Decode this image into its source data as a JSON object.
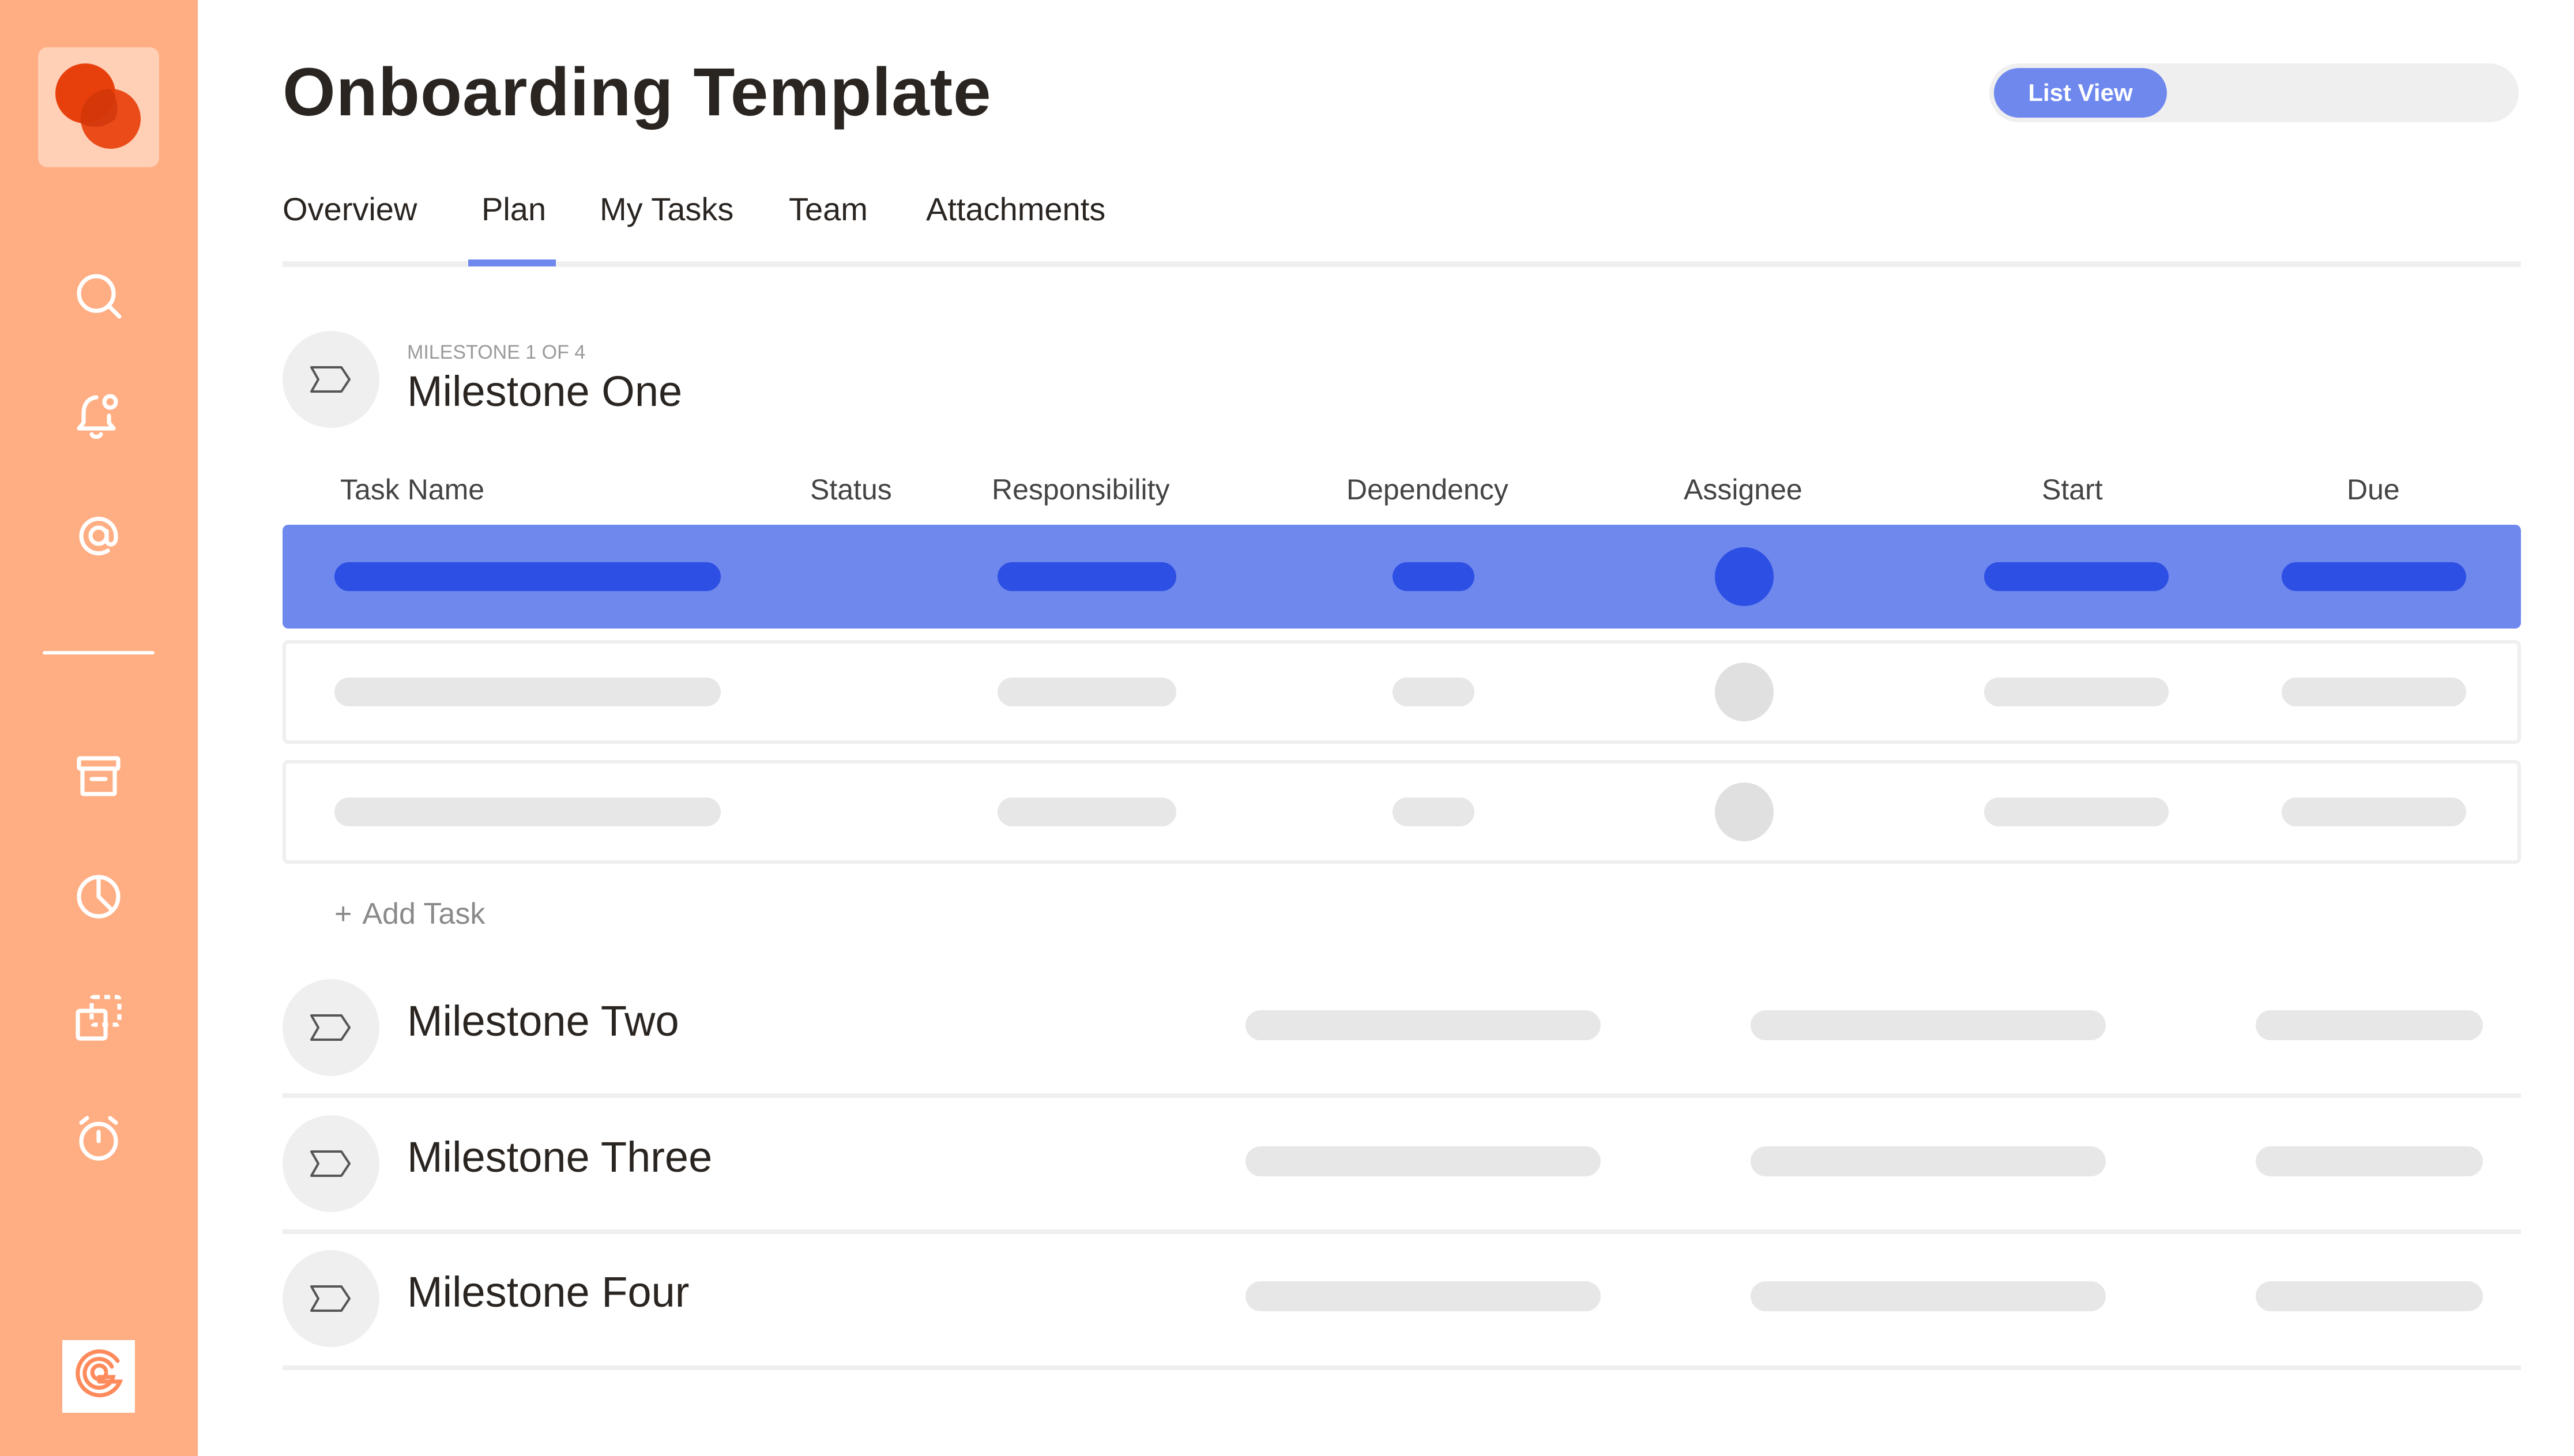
{
  "app": {
    "accent_color": "#6e88ee",
    "sidebar_color": "#ffad82",
    "logo_name": "overlapping-circles-logo",
    "brand_badge_name": "g-brand-icon"
  },
  "sidebar": {
    "icons": [
      "search-icon",
      "bell-icon",
      "at-sign-icon",
      "archive-icon",
      "pie-chart-icon",
      "duplicate-icon",
      "stopwatch-icon"
    ]
  },
  "header": {
    "title": "Onboarding Template",
    "view_toggle": {
      "selected": "List View"
    }
  },
  "tabs": [
    {
      "label": "Overview",
      "active": false
    },
    {
      "label": "Plan",
      "active": true
    },
    {
      "label": "My Tasks",
      "active": false
    },
    {
      "label": "Team",
      "active": false
    },
    {
      "label": "Attachments",
      "active": false
    }
  ],
  "milestones": [
    {
      "kicker": "MILESTONE 1 OF 4",
      "title": "Milestone One",
      "expanded": true
    },
    {
      "title": "Milestone Two",
      "expanded": false
    },
    {
      "title": "Milestone Three",
      "expanded": false
    },
    {
      "title": "Milestone Four",
      "expanded": false
    }
  ],
  "table": {
    "columns": [
      "Task Name",
      "Status",
      "Responsibility",
      "Dependency",
      "Assignee",
      "Start",
      "Due"
    ],
    "rows": [
      {
        "state": "selected"
      },
      {
        "state": "placeholder"
      },
      {
        "state": "placeholder"
      }
    ],
    "add_task_label": "Add Task",
    "add_task_icon": "plus-icon"
  }
}
